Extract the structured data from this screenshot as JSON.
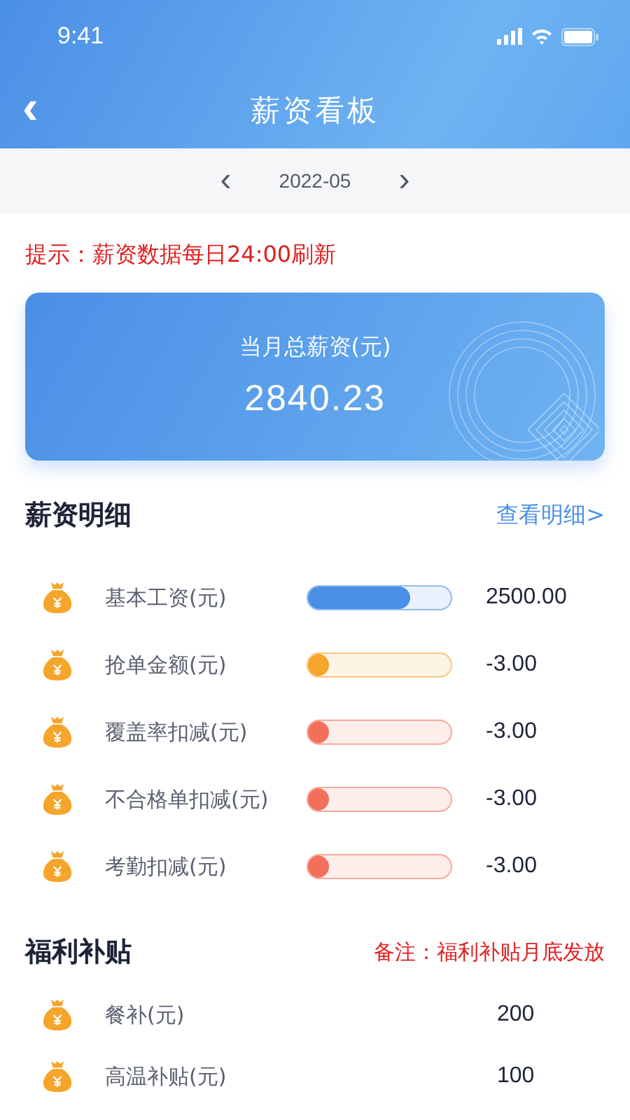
{
  "status_bar": {
    "time": "9:41"
  },
  "nav": {
    "back": "‹",
    "title": "薪资看板"
  },
  "month_picker": {
    "prev": "‹",
    "month": "2022-05",
    "next": "›"
  },
  "notice": "提示：薪资数据每日24:00刷新",
  "total_card": {
    "label": "当月总薪资(元)",
    "amount": "2840.23"
  },
  "salary_detail": {
    "title": "薪资明细",
    "link": "查看明细>",
    "items": [
      {
        "label": "基本工资(元)",
        "level": 0.72,
        "color": "#4a8fe6",
        "amount": "2500.00"
      },
      {
        "label": "抢单金额(元)",
        "level": 0.15,
        "color": "#f5a52a",
        "amount": "-3.00"
      },
      {
        "label": "覆盖率扣减(元)",
        "level": 0.15,
        "color": "#f36f5c",
        "amount": "-3.00"
      },
      {
        "label": "不合格单扣减(元)",
        "level": 0.15,
        "color": "#f36f5c",
        "amount": "-3.00"
      },
      {
        "label": "考勤扣减(元)",
        "level": 0.15,
        "color": "#f36f5c",
        "amount": "-3.00"
      }
    ]
  },
  "welfare": {
    "title": "福利补贴",
    "note": "备注：福利补贴月底发放",
    "items": [
      {
        "label": "餐补(元)",
        "amount": "200"
      },
      {
        "label": "高温补贴(元)",
        "amount": "100"
      }
    ]
  }
}
